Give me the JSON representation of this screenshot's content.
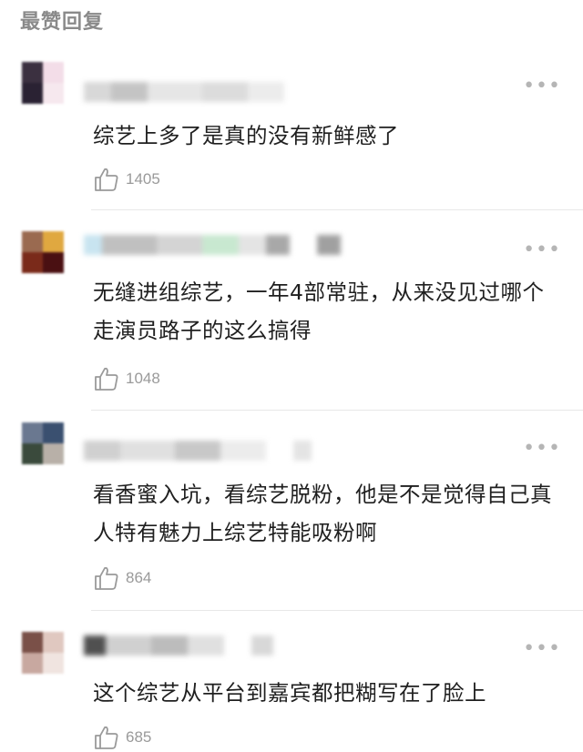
{
  "section_title": "最赞回复",
  "comments": [
    {
      "text": "综艺上多了是真的没有新鲜感了",
      "likes": "1405",
      "avatar_colors": [
        "#3b3040",
        "#f3dde8",
        "#2a2233",
        "#f6e8ee"
      ]
    },
    {
      "text": "无缝进组综艺，一年4部常驻，从来没见过哪个走演员路子的这么搞得",
      "likes": "1048",
      "avatar_colors": [
        "#9a6a50",
        "#e0a840",
        "#7a2a1a",
        "#4a1012"
      ]
    },
    {
      "text": "看香蜜入坑，看综艺脱粉，他是不是觉得自己真人特有魅力上综艺特能吸粉啊",
      "likes": "864",
      "avatar_colors": [
        "#6a7890",
        "#3a5070",
        "#3a4a3c",
        "#b8b0a8"
      ]
    },
    {
      "text": "这个综艺从平台到嘉宾都把糊写在了脸上",
      "likes": "685",
      "avatar_colors": [
        "#7a5048",
        "#e0c8c0",
        "#c8a8a0",
        "#f0e4e0"
      ]
    }
  ],
  "icons": {
    "more": "more-dots-icon",
    "like": "thumbs-up-icon"
  }
}
